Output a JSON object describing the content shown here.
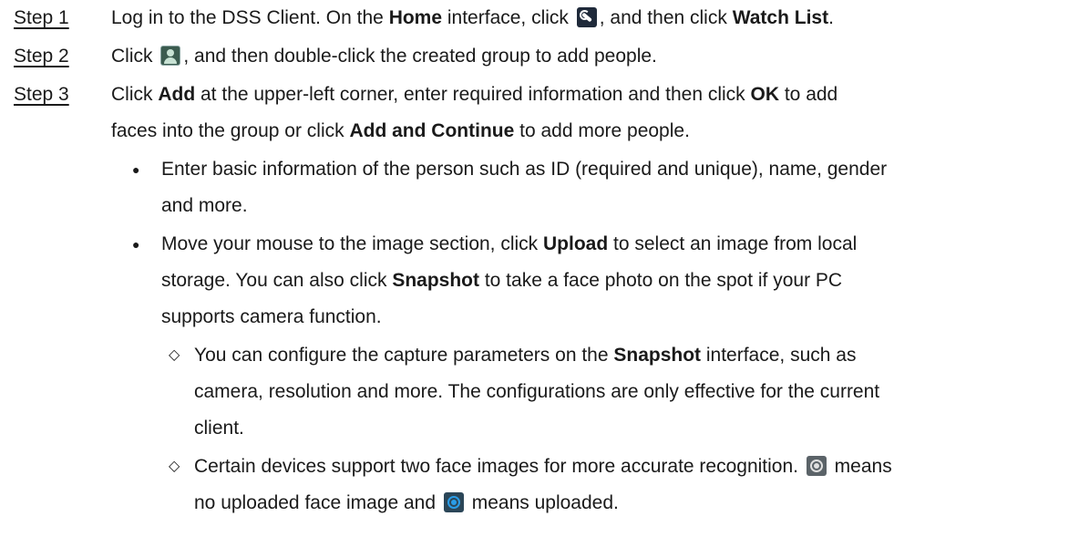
{
  "steps": [
    {
      "label": "Step 1",
      "lines": [
        {
          "t1": "Log in to the DSS Client. On the ",
          "b1": "Home",
          "t2": " interface, click ",
          "t3": ", and then click ",
          "b2": "Watch List",
          "t4": "."
        }
      ]
    },
    {
      "label": "Step 2",
      "lines": [
        {
          "t1": "Click ",
          "t2": ", and then double-click the created group to add people."
        }
      ]
    },
    {
      "label": "Step 3",
      "lines": [
        {
          "t1": "Click ",
          "b1": "Add",
          "t2": " at the upper-left corner, enter required information and then click ",
          "b2": "OK",
          "t3": " to add"
        },
        {
          "t1": "faces into the group or click ",
          "b1": "Add and Continue",
          "t2": " to add more people."
        }
      ]
    }
  ],
  "bullets": [
    {
      "mark": "●",
      "lines": [
        "Enter basic information of the person such as ID (required and unique), name, gender",
        "and more."
      ]
    },
    {
      "mark": "●",
      "line1": {
        "t1": "Move your mouse to the image section, click ",
        "b1": "Upload",
        "t2": " to select an image from local"
      },
      "line2": {
        "t1": "storage. You can also click ",
        "b1": "Snapshot",
        "t2": " to take a face photo on the spot if your PC"
      },
      "line3": "supports camera function."
    }
  ],
  "subbullets": [
    {
      "mark": "◇",
      "line1": {
        "t1": "You can configure the capture parameters on the ",
        "b1": "Snapshot",
        "t2": " interface, such as"
      },
      "line2": "camera, resolution and more. The configurations are only effective for the current",
      "line3": "client."
    },
    {
      "mark": "◇",
      "line1": {
        "t1": "Certain devices support two face images for more accurate recognition. ",
        "t2": " means"
      },
      "line2": {
        "t1": "no uploaded face image and ",
        "t2": " means uploaded."
      }
    }
  ],
  "icons": {
    "wrench": "wrench-icon",
    "person_group": "person-group-icon",
    "face_not_uploaded": "face-not-uploaded-icon",
    "face_uploaded": "face-uploaded-icon"
  },
  "colors": {
    "text": "#1a1a1a",
    "face_uploaded_accent": "#2a9de8"
  }
}
